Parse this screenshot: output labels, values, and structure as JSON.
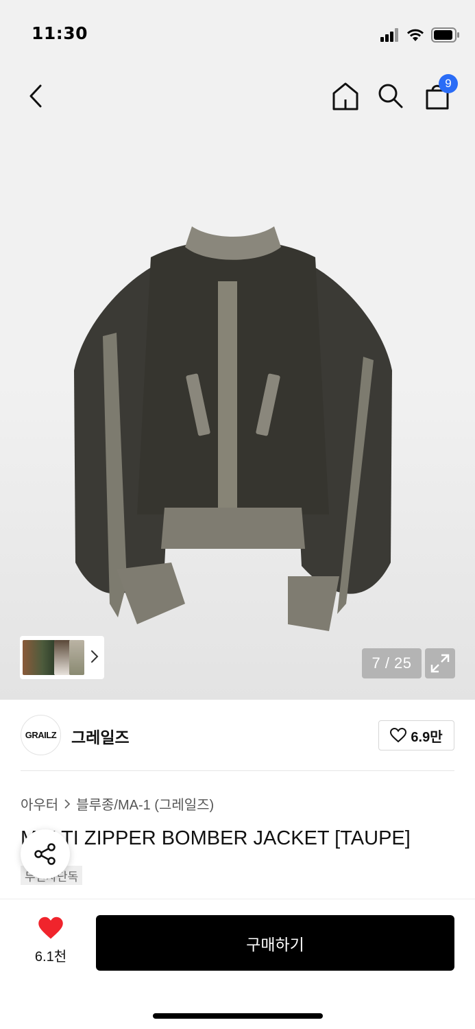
{
  "status_bar": {
    "time": "11:30"
  },
  "nav": {
    "cart_count": "9"
  },
  "gallery": {
    "counter": "7 / 25"
  },
  "brand": {
    "logo_text": "GRAILZ",
    "name": "그레일즈",
    "like_count": "6.9만"
  },
  "breadcrumb": {
    "category": "아우터",
    "subcategory": "블루종/MA-1 (그레일즈)"
  },
  "product": {
    "title": "MULTI ZIPPER BOMBER JACKET [TAUPE]",
    "badge": "무신사단독"
  },
  "bottom": {
    "fav_count": "6.1천",
    "buy_label": "구매하기"
  },
  "colors": {
    "heart": "#f0242c",
    "badge_blue": "#2a6cf6",
    "jacket": "#3f3d37",
    "trim": "#8c8a7f"
  }
}
